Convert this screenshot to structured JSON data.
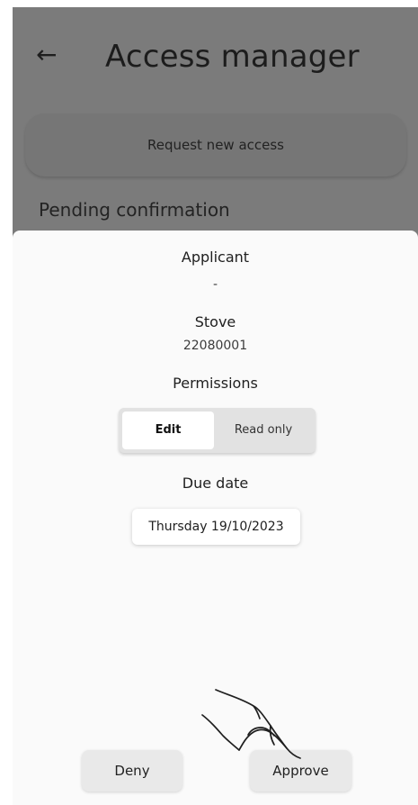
{
  "header": {
    "back_icon": "back-arrow-icon",
    "title": "Access manager"
  },
  "main": {
    "request_button_label": "Request new access",
    "pending_label": "Pending confirmation"
  },
  "sheet": {
    "applicant_title": "Applicant",
    "applicant_value": "-",
    "stove_title": "Stove",
    "stove_value": "22080001",
    "permissions_title": "Permissions",
    "permissions": {
      "selected": "Edit",
      "options": [
        "Edit",
        "Read only"
      ]
    },
    "due_date_title": "Due date",
    "due_date_value": "Thursday 19/10/2023",
    "deny_label": "Deny",
    "approve_label": "Approve"
  },
  "overlay": {
    "gesture_icon": "hand-pointer-icon"
  }
}
